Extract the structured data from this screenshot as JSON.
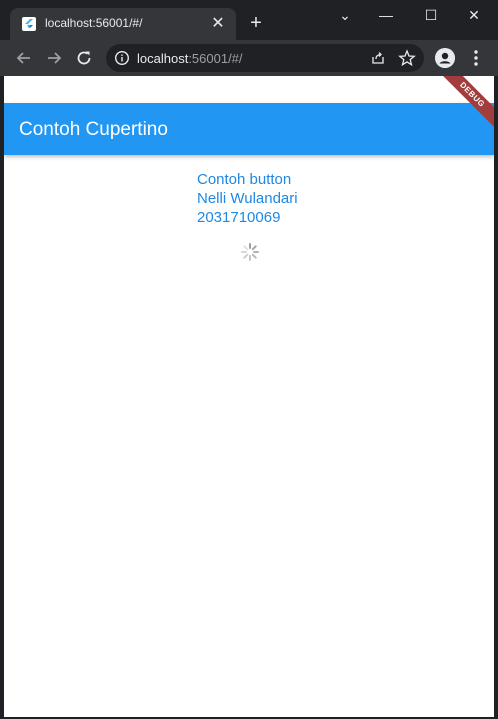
{
  "browser": {
    "tab": {
      "title": "localhost:56001/#/",
      "close_glyph": "✕"
    },
    "new_tab_glyph": "+",
    "window_controls": {
      "chevron": "⌄",
      "minimize": "—",
      "maximize": "☐",
      "close": "✕"
    },
    "address": {
      "host": "localhost",
      "rest": ":56001/#/"
    },
    "icons": {
      "favicon": "flutter-icon",
      "back": "back-arrow-icon",
      "forward": "forward-arrow-icon",
      "reload": "reload-icon",
      "info": "info-icon",
      "share": "share-icon",
      "bookmark": "star-icon",
      "profile": "profile-icon",
      "menu": "kebab-menu-icon"
    }
  },
  "app": {
    "title": "Contoh Cupertino",
    "lines": [
      "Contoh button",
      "Nelli Wulandari",
      "2031710069"
    ],
    "debug_banner": "DEBUG",
    "colors": {
      "appbar": "#2196f3",
      "text": "#1e88e5",
      "ribbon": "#a13d3d"
    }
  }
}
